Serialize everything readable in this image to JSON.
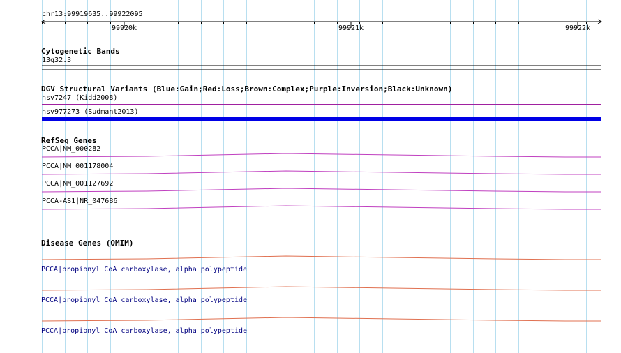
{
  "ruler": {
    "location": "chr13:99919635..99922095",
    "ticks": [
      {
        "label": "99920k"
      },
      {
        "label": "99921k"
      },
      {
        "label": "99922k"
      }
    ]
  },
  "tracks": {
    "cytobands": {
      "title": "Cytogenetic Bands",
      "features": [
        {
          "label": "13q32.3"
        }
      ]
    },
    "dgv": {
      "title": "DGV Structural Variants (Blue:Gain;Red:Loss;Brown:Complex;Purple:Inversion;Black:Unknown)",
      "features": [
        {
          "label": "nsv7247 (Kidd2008)",
          "color": "#a020a0"
        },
        {
          "label": "nsv977273 (Sudmant2013)",
          "color": "#0000e6"
        }
      ]
    },
    "refseq": {
      "title": "RefSeq Genes",
      "color": "#c040c0",
      "features": [
        {
          "label": "PCCA|NM_000282"
        },
        {
          "label": "PCCA|NM_001178004"
        },
        {
          "label": "PCCA|NM_001127692"
        },
        {
          "label": "PCCA-AS1|NR_047686"
        }
      ]
    },
    "omim": {
      "title": "Disease Genes (OMIM)",
      "color": "#e07050",
      "features": [
        {
          "label": "PCCA|propionyl CoA carboxylase, alpha polypeptide"
        },
        {
          "label": "PCCA|propionyl CoA carboxylase, alpha polypeptide"
        },
        {
          "label": "PCCA|propionyl CoA carboxylase, alpha polypeptide"
        }
      ]
    }
  },
  "colors": {
    "grid": "#b8dff0",
    "axis": "#000000"
  }
}
